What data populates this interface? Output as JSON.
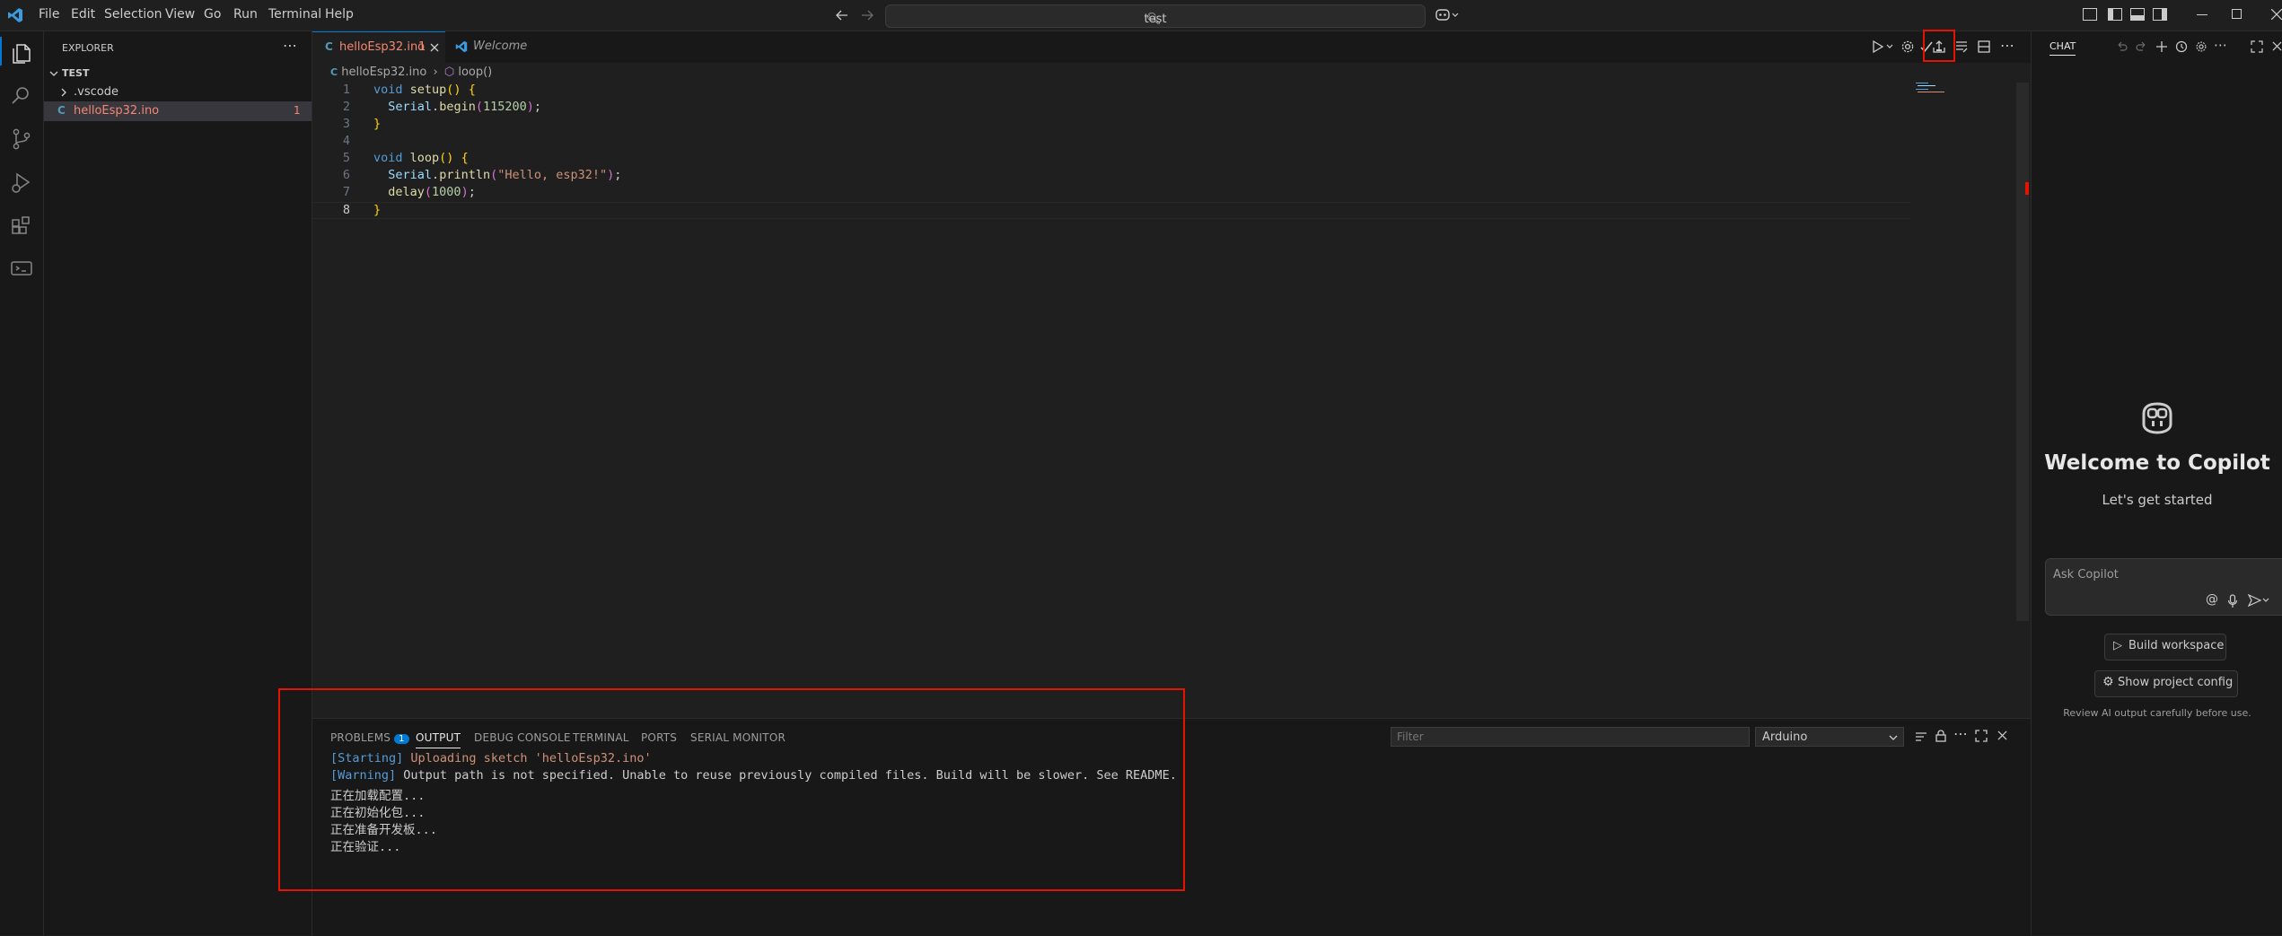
{
  "menu": [
    "File",
    "Edit",
    "Selection",
    "View",
    "Go",
    "Run",
    "Terminal",
    "Help"
  ],
  "search": {
    "text": "test"
  },
  "explorer": {
    "title": "EXPLORER",
    "folder": "TEST",
    "items": [
      {
        "name": ".vscode"
      },
      {
        "name": "helloEsp32.ino",
        "badge": "1"
      }
    ]
  },
  "tabs": [
    {
      "label": "helloEsp32.ino",
      "badge": "1"
    },
    {
      "label": "Welcome"
    }
  ],
  "breadcrumb": {
    "file": "helloEsp32.ino",
    "symbol": "loop()"
  },
  "code": [
    "1",
    "2",
    "3",
    "4",
    "5",
    "6",
    "7",
    "8"
  ],
  "panel": {
    "tabs": [
      "PROBLEMS",
      "OUTPUT",
      "DEBUG CONSOLE",
      "TERMINAL",
      "PORTS",
      "SERIAL MONITOR"
    ],
    "problems_count": "1",
    "filter_placeholder": "Filter",
    "channel": "Arduino",
    "output": [
      {
        "tag": "[Starting]",
        "text": " Uploading sketch 'helloEsp32.ino'"
      },
      {
        "tag": "[Warning]",
        "text": " Output path is not specified. Unable to reuse previously compiled files. Build will be slower. See README."
      },
      {
        "tag": "",
        "text": "正在加载配置..."
      },
      {
        "tag": "",
        "text": "正在初始化包..."
      },
      {
        "tag": "",
        "text": "正在准备开发板..."
      },
      {
        "tag": "",
        "text": "正在验证..."
      }
    ]
  },
  "chat": {
    "title": "CHAT",
    "welcome": "Welcome to Copilot",
    "subtitle": "Let's get started",
    "input_placeholder": "Ask Copilot",
    "build_workspace": "Build workspace",
    "show_config": "Show project config",
    "disclaimer": "Review AI output carefully before use."
  },
  "colors": {
    "accent": "#0078d4",
    "highlight": "#e51400",
    "error": "#f48771"
  }
}
